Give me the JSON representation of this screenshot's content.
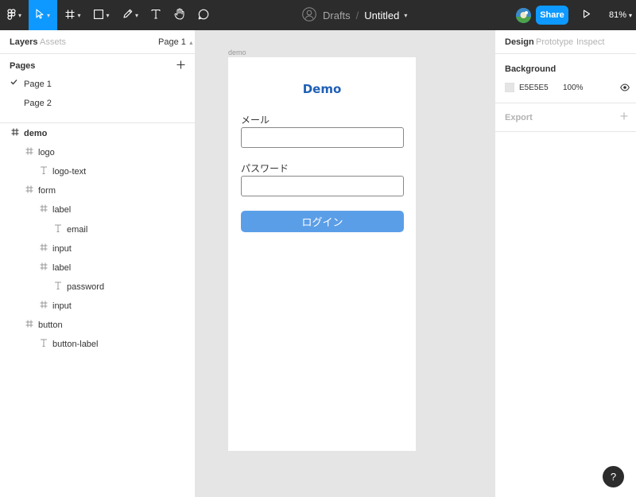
{
  "toolbar": {
    "title_prefix": "Drafts",
    "title_sep": "/",
    "file_name": "Untitled",
    "share_label": "Share",
    "zoom": "81%"
  },
  "left_panel": {
    "tabs": [
      "Layers",
      "Assets"
    ],
    "current_page": "Page 1",
    "pages_heading": "Pages",
    "pages": [
      {
        "label": "Page 1",
        "selected": true
      },
      {
        "label": "Page 2",
        "selected": false
      }
    ],
    "layers": [
      {
        "name": "demo",
        "type": "frame",
        "depth": 0
      },
      {
        "name": "logo",
        "type": "frame",
        "depth": 1
      },
      {
        "name": "logo-text",
        "type": "text",
        "depth": 2
      },
      {
        "name": "form",
        "type": "frame",
        "depth": 1
      },
      {
        "name": "label",
        "type": "frame",
        "depth": 2
      },
      {
        "name": "email",
        "type": "text",
        "depth": 3
      },
      {
        "name": "input",
        "type": "frame",
        "depth": 2
      },
      {
        "name": "label",
        "type": "frame",
        "depth": 2
      },
      {
        "name": "password",
        "type": "text",
        "depth": 3
      },
      {
        "name": "input",
        "type": "frame",
        "depth": 2
      },
      {
        "name": "button",
        "type": "frame",
        "depth": 1
      },
      {
        "name": "button-label",
        "type": "text",
        "depth": 2
      }
    ]
  },
  "canvas": {
    "frame_name": "demo",
    "logo": "Demo",
    "email_label": "メール",
    "password_label": "パスワード",
    "button_label": "ログイン",
    "colors": {
      "logo": "#1f5fb6",
      "button": "#5b9ee8",
      "background": "#e5e5e5"
    }
  },
  "right_panel": {
    "tabs": [
      "Design",
      "Prototype",
      "Inspect"
    ],
    "background_heading": "Background",
    "background_hex": "E5E5E5",
    "background_opacity": "100%",
    "export_heading": "Export"
  },
  "help_label": "?"
}
